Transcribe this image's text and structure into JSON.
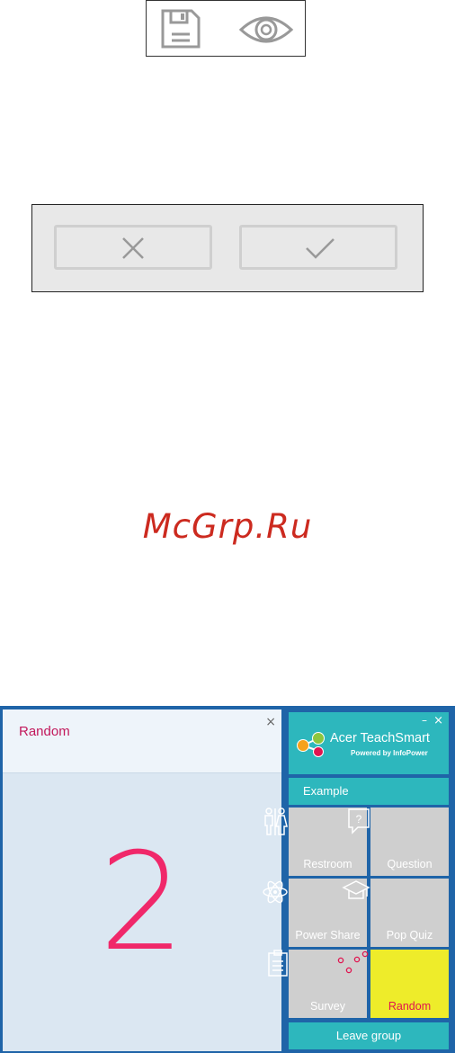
{
  "toolbar_icons": {
    "save_icon": "floppy-disk-icon",
    "view_icon": "eye-icon"
  },
  "dialog_icons": {
    "cancel_icon": "x-icon",
    "confirm_icon": "check-icon"
  },
  "watermark": "McGrp.Ru",
  "random_panel": {
    "title": "Random",
    "close_glyph": "×",
    "number": "2"
  },
  "app": {
    "brand_name": "Acer TeachSmart",
    "brand_sub": "Powered by InfoPower",
    "min_glyph": "–",
    "close_glyph": "×",
    "group_name": "Example",
    "tiles": [
      {
        "label": "Restroom",
        "icon": "restroom-icon"
      },
      {
        "label": "Question",
        "icon": "question-icon"
      },
      {
        "label": "Power Share",
        "icon": "atom-icon"
      },
      {
        "label": "Pop Quiz",
        "icon": "graduation-cap-icon"
      },
      {
        "label": "Survey",
        "icon": "clipboard-icon"
      },
      {
        "label": "Random",
        "icon": "random-dots-icon"
      }
    ],
    "leave_label": "Leave group"
  },
  "colors": {
    "accent": "#2db7bd",
    "frame": "#1f64a8",
    "highlight": "#eeec2a",
    "number": "#f0286a",
    "watermark": "#cc2a1f"
  }
}
